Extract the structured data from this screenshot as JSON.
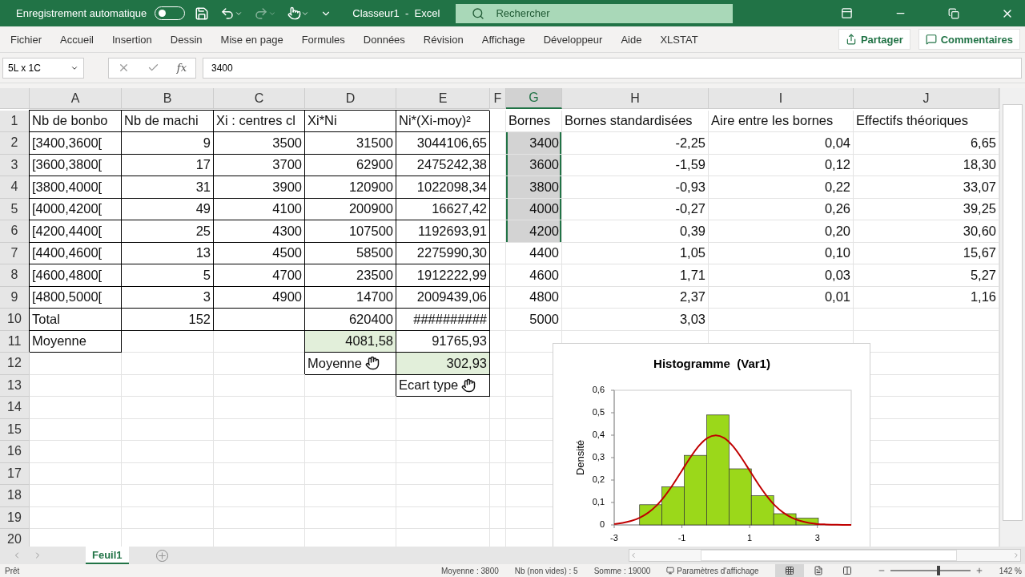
{
  "title_bar": {
    "autosave_label": "Enregistrement automatique",
    "autosave_on": false,
    "redo_disabled": true,
    "title": "Classeur1  -  Excel",
    "search": {
      "placeholder": "Rechercher"
    }
  },
  "ribbon": {
    "tabs": [
      "Fichier",
      "Accueil",
      "Insertion",
      "Dessin",
      "Mise en page",
      "Formules",
      "Données",
      "Révision",
      "Affichage",
      "Développeur",
      "Aide",
      "XLSTAT"
    ],
    "share": "Partager",
    "comments": "Commentaires"
  },
  "formula_bar": {
    "name_box": "5L x 1C",
    "fx": "fx",
    "value": "3400"
  },
  "sheet": {
    "columns": [
      {
        "label": "A",
        "selected": false
      },
      {
        "label": "B",
        "selected": false
      },
      {
        "label": "C",
        "selected": false
      },
      {
        "label": "D",
        "selected": false
      },
      {
        "label": "E",
        "selected": false
      },
      {
        "label": "F",
        "selected": false
      },
      {
        "label": "G",
        "selected": true
      },
      {
        "label": "H",
        "selected": false
      },
      {
        "label": "I",
        "selected": false
      },
      {
        "label": "J",
        "selected": false
      }
    ],
    "rows": [
      {
        "header": "1",
        "cells": [
          {
            "text": "Nb de bonbo",
            "kind": "text",
            "boxed": true
          },
          {
            "text": "Nb de machi",
            "kind": "text",
            "boxed": true
          },
          {
            "text": "Xi : centres cl",
            "kind": "text",
            "boxed": true
          },
          {
            "text": "Xi*Ni",
            "kind": "text",
            "boxed": true
          },
          {
            "text": "Ni*(Xi-moy)²",
            "kind": "text",
            "boxed": true
          },
          {
            "kind": "empty"
          },
          {
            "text": "Bornes",
            "kind": "text"
          },
          {
            "text": "Bornes standardisées",
            "kind": "text"
          },
          {
            "text": "Aire entre les bornes",
            "kind": "text"
          },
          {
            "text": "Effectifs théoriques",
            "kind": "text"
          }
        ]
      },
      {
        "header": "2",
        "cells": [
          {
            "text": "[3400,3600[",
            "kind": "text",
            "boxed": true
          },
          {
            "text": "9",
            "kind": "number",
            "boxed": true
          },
          {
            "text": "3500",
            "kind": "number",
            "boxed": true
          },
          {
            "text": "31500",
            "kind": "number",
            "boxed": true
          },
          {
            "text": "3044106,65",
            "kind": "number",
            "boxed": true
          },
          {
            "kind": "empty"
          },
          {
            "text": "3400",
            "kind": "number",
            "selected": true
          },
          {
            "text": "-2,25",
            "kind": "number"
          },
          {
            "text": "0,04",
            "kind": "number"
          },
          {
            "text": "6,65",
            "kind": "number"
          }
        ]
      },
      {
        "header": "3",
        "cells": [
          {
            "text": "[3600,3800[",
            "kind": "text",
            "boxed": true
          },
          {
            "text": "17",
            "kind": "number",
            "boxed": true
          },
          {
            "text": "3700",
            "kind": "number",
            "boxed": true
          },
          {
            "text": "62900",
            "kind": "number",
            "boxed": true
          },
          {
            "text": "2475242,38",
            "kind": "number",
            "boxed": true
          },
          {
            "kind": "empty"
          },
          {
            "text": "3600",
            "kind": "number",
            "selected": true
          },
          {
            "text": "-1,59",
            "kind": "number"
          },
          {
            "text": "0,12",
            "kind": "number"
          },
          {
            "text": "18,30",
            "kind": "number"
          }
        ]
      },
      {
        "header": "4",
        "cells": [
          {
            "text": "[3800,4000[",
            "kind": "text",
            "boxed": true
          },
          {
            "text": "31",
            "kind": "number",
            "boxed": true
          },
          {
            "text": "3900",
            "kind": "number",
            "boxed": true
          },
          {
            "text": "120900",
            "kind": "number",
            "boxed": true
          },
          {
            "text": "1022098,34",
            "kind": "number",
            "boxed": true
          },
          {
            "kind": "empty"
          },
          {
            "text": "3800",
            "kind": "number",
            "selected": true
          },
          {
            "text": "-0,93",
            "kind": "number"
          },
          {
            "text": "0,22",
            "kind": "number"
          },
          {
            "text": "33,07",
            "kind": "number"
          }
        ]
      },
      {
        "header": "5",
        "cells": [
          {
            "text": "[4000,4200[",
            "kind": "text",
            "boxed": true
          },
          {
            "text": "49",
            "kind": "number",
            "boxed": true
          },
          {
            "text": "4100",
            "kind": "number",
            "boxed": true
          },
          {
            "text": "200900",
            "kind": "number",
            "boxed": true
          },
          {
            "text": "16627,42",
            "kind": "number",
            "boxed": true
          },
          {
            "kind": "empty"
          },
          {
            "text": "4000",
            "kind": "number",
            "selected": true
          },
          {
            "text": "-0,27",
            "kind": "number"
          },
          {
            "text": "0,26",
            "kind": "number"
          },
          {
            "text": "39,25",
            "kind": "number"
          }
        ]
      },
      {
        "header": "6",
        "cells": [
          {
            "text": "[4200,4400[",
            "kind": "text",
            "boxed": true
          },
          {
            "text": "25",
            "kind": "number",
            "boxed": true
          },
          {
            "text": "4300",
            "kind": "number",
            "boxed": true
          },
          {
            "text": "107500",
            "kind": "number",
            "boxed": true
          },
          {
            "text": "1192693,91",
            "kind": "number",
            "boxed": true
          },
          {
            "kind": "empty"
          },
          {
            "text": "4200",
            "kind": "number",
            "selected": true
          },
          {
            "text": "0,39",
            "kind": "number"
          },
          {
            "text": "0,20",
            "kind": "number"
          },
          {
            "text": "30,60",
            "kind": "number"
          }
        ]
      },
      {
        "header": "7",
        "cells": [
          {
            "text": "[4400,4600[",
            "kind": "text",
            "boxed": true
          },
          {
            "text": "13",
            "kind": "number",
            "boxed": true
          },
          {
            "text": "4500",
            "kind": "number",
            "boxed": true
          },
          {
            "text": "58500",
            "kind": "number",
            "boxed": true
          },
          {
            "text": "2275990,30",
            "kind": "number",
            "boxed": true
          },
          {
            "kind": "empty"
          },
          {
            "text": "4400",
            "kind": "number",
            "selected": false
          },
          {
            "text": "1,05",
            "kind": "number"
          },
          {
            "text": "0,10",
            "kind": "number"
          },
          {
            "text": "15,67",
            "kind": "number"
          }
        ]
      },
      {
        "header": "8",
        "cells": [
          {
            "text": "[4600,4800[",
            "kind": "text",
            "boxed": true
          },
          {
            "text": "5",
            "kind": "number",
            "boxed": true
          },
          {
            "text": "4700",
            "kind": "number",
            "boxed": true
          },
          {
            "text": "23500",
            "kind": "number",
            "boxed": true
          },
          {
            "text": "1912222,99",
            "kind": "number",
            "boxed": true
          },
          {
            "kind": "empty"
          },
          {
            "text": "4600",
            "kind": "number",
            "selected": false
          },
          {
            "text": "1,71",
            "kind": "number"
          },
          {
            "text": "0,03",
            "kind": "number"
          },
          {
            "text": "5,27",
            "kind": "number"
          }
        ]
      },
      {
        "header": "9",
        "cells": [
          {
            "text": "[4800,5000[",
            "kind": "text",
            "boxed": true
          },
          {
            "text": "3",
            "kind": "number",
            "boxed": true
          },
          {
            "text": "4900",
            "kind": "number",
            "boxed": true
          },
          {
            "text": "14700",
            "kind": "number",
            "boxed": true
          },
          {
            "text": "2009439,06",
            "kind": "number",
            "boxed": true
          },
          {
            "kind": "empty"
          },
          {
            "text": "4800",
            "kind": "number",
            "selected": false
          },
          {
            "text": "2,37",
            "kind": "number"
          },
          {
            "text": "0,01",
            "kind": "number"
          },
          {
            "text": "1,16",
            "kind": "number"
          }
        ]
      },
      {
        "header": "10",
        "cells": [
          {
            "text": "Total",
            "kind": "text",
            "boxed": true
          },
          {
            "text": "152",
            "kind": "number",
            "boxed": true
          },
          {
            "kind": "empty",
            "boxed": true
          },
          {
            "text": "620400",
            "kind": "number",
            "boxed": true
          },
          {
            "text": "##########",
            "kind": "number",
            "boxed": true
          },
          {
            "kind": "empty"
          },
          {
            "text": "5000",
            "kind": "number",
            "selected": false
          },
          {
            "text": "3,03",
            "kind": "number"
          },
          {
            "kind": "empty"
          },
          {
            "kind": "empty"
          }
        ]
      },
      {
        "header": "11",
        "cells": [
          {
            "text": "Moyenne",
            "kind": "text",
            "boxed": true
          },
          {
            "kind": "empty"
          },
          {
            "kind": "empty"
          },
          {
            "text": "4081,58",
            "kind": "number",
            "boxed": true,
            "highlighted": true
          },
          {
            "text": "91765,93",
            "kind": "number",
            "boxed": true,
            "highlighted": false
          },
          {
            "kind": "empty"
          },
          {
            "kind": "empty"
          },
          {
            "kind": "empty"
          },
          {
            "kind": "empty"
          },
          {
            "kind": "empty"
          }
        ]
      },
      {
        "header": "12",
        "cells": [
          {
            "kind": "empty"
          },
          {
            "kind": "empty"
          },
          {
            "kind": "empty"
          },
          {
            "text": "Moyenne",
            "kind": "text",
            "boxed": true,
            "pointer": true
          },
          {
            "text": "302,93",
            "kind": "number",
            "boxed": true,
            "highlighted": true
          },
          {
            "kind": "empty"
          },
          {
            "kind": "empty"
          },
          {
            "kind": "empty"
          },
          {
            "kind": "empty"
          },
          {
            "kind": "empty"
          }
        ]
      },
      {
        "header": "13",
        "cells": [
          {
            "kind": "empty"
          },
          {
            "kind": "empty"
          },
          {
            "kind": "empty"
          },
          {
            "kind": "empty"
          },
          {
            "text": "Ecart type",
            "kind": "text",
            "boxed": true,
            "pointer": true
          },
          {
            "kind": "empty"
          },
          {
            "kind": "empty"
          },
          {
            "kind": "empty"
          },
          {
            "kind": "empty"
          },
          {
            "kind": "empty"
          }
        ]
      },
      {
        "header": "14"
      },
      {
        "header": "15"
      },
      {
        "header": "16"
      },
      {
        "header": "17"
      },
      {
        "header": "18"
      },
      {
        "header": "19"
      },
      {
        "header": "20"
      }
    ],
    "chart": {
      "chart_data": {
        "type": "bar",
        "title": "Histogramme  (Var1)",
        "ylabel": "Densité",
        "x": [
          -1.92,
          -1.26,
          -0.6,
          0.06,
          0.72,
          1.38,
          2.04,
          2.7
        ],
        "series": [
          {
            "color": "#9bd81a",
            "values": [
              0.09,
              0.17,
              0.31,
              0.49,
              0.25,
              0.13,
              0.05,
              0.03
            ]
          },
          {
            "type": "line",
            "color": "#c00000",
            "x": [
              -3,
              -2.75,
              -2.5,
              -2.25,
              -2,
              -1.75,
              -1.5,
              -1.25,
              -1,
              -0.75,
              -0.5,
              -0.25,
              0,
              0.25,
              0.5,
              0.75,
              1,
              1.25,
              1.5,
              1.75,
              2,
              2.25,
              2.5,
              2.75,
              3,
              3.25,
              3.5,
              3.75,
              4
            ],
            "values": [
              0.004,
              0.009,
              0.018,
              0.032,
              0.054,
              0.086,
              0.13,
              0.183,
              0.242,
              0.301,
              0.352,
              0.387,
              0.399,
              0.387,
              0.352,
              0.301,
              0.242,
              0.183,
              0.13,
              0.086,
              0.054,
              0.032,
              0.018,
              0.009,
              0.004,
              0.002,
              0.001,
              0,
              0
            ]
          }
        ],
        "xlim": [
          -3,
          4
        ],
        "ylim": [
          0,
          0.6
        ],
        "xticks": [
          {
            "value": -3,
            "label": "-3"
          },
          {
            "value": -1,
            "label": "-1"
          },
          {
            "value": 1,
            "label": "1"
          },
          {
            "value": 3,
            "label": "3"
          }
        ],
        "yticks": [
          {
            "value": 0,
            "label": "0"
          },
          {
            "value": 0.1,
            "label": "0,1"
          },
          {
            "value": 0.2,
            "label": "0,2"
          },
          {
            "value": 0.3,
            "label": "0,3"
          },
          {
            "value": 0.4,
            "label": "0,4"
          },
          {
            "value": 0.5,
            "label": "0,5"
          },
          {
            "value": 0.6,
            "label": "0,6"
          }
        ]
      }
    }
  },
  "sheet_tabs": [
    {
      "label": "Feuil1",
      "selected": true
    }
  ],
  "status_bar": {
    "state": "Prêt",
    "average": "Moyenne : 3800",
    "count": "Nb (non vides) : 5",
    "sum": "Somme : 19000",
    "display_settings": "Paramètres d'affichage",
    "views": [
      {
        "kind": "normal",
        "selected": true
      },
      {
        "kind": "page",
        "selected": false
      },
      {
        "kind": "break",
        "selected": false
      }
    ],
    "zoom": {
      "level": 0.6,
      "label": "142 %"
    }
  }
}
